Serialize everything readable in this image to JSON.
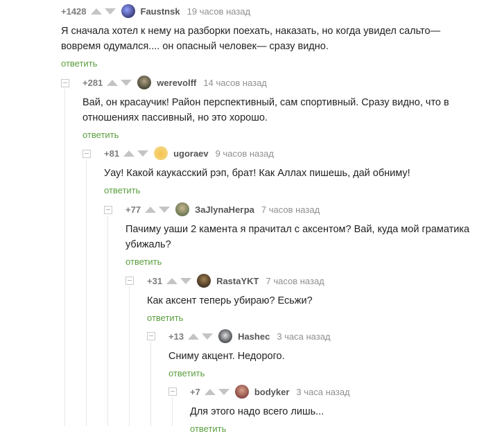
{
  "comments": [
    {
      "rating": "+1428",
      "author": "Faustnsk",
      "time": "19 часов назад",
      "text": "Я сначала хотел к нему на разборки поехать, наказать, но когда увидел сальто— вовремя одумался.... он опасный человек— сразу видно.",
      "reply": "ответить",
      "avatar_color": "#3e3f7a"
    },
    {
      "rating": "+281",
      "author": "werevolff",
      "time": "14 часов назад",
      "text": "Вай, он красаучик! Район перспективный, сам спортивный. Сразу видно, что в отношениях пассивный, но это хорошо.",
      "reply": "ответить",
      "avatar_color": "#4a4a3a"
    },
    {
      "rating": "+81",
      "author": "ugoraev",
      "time": "9 часов назад",
      "text": "Уау! Какой каукасский рэп, брат! Как Аллах пишешь, дай обниму!",
      "reply": "ответить",
      "avatar_color": "#f2d680"
    },
    {
      "rating": "+77",
      "author": "ЗаJlynaНегра",
      "time": "7 часов назад",
      "text": "Пачиму уаши 2 камента я прачитал с аксентом? Вай, куда мой граматика убижаль?",
      "reply": "ответить",
      "avatar_color": "#6b7a55"
    },
    {
      "rating": "+31",
      "author": "RastaYKT",
      "time": "7 часов назад",
      "text": "Как аксент теперь убираю? Есьжи?",
      "reply": "ответить",
      "avatar_color": "#6e5a3a"
    },
    {
      "rating": "+13",
      "author": "Hashec",
      "time": "3 часа назад",
      "text": "Сниму акцент. Недорого.",
      "reply": "ответить",
      "avatar_color": "#55575c"
    },
    {
      "rating": "+7",
      "author": "bodyker",
      "time": "3 часа назад",
      "text": "Для этого надо всего лишь...",
      "reply": "ответить",
      "avatar_color": "#8a4a45"
    }
  ]
}
